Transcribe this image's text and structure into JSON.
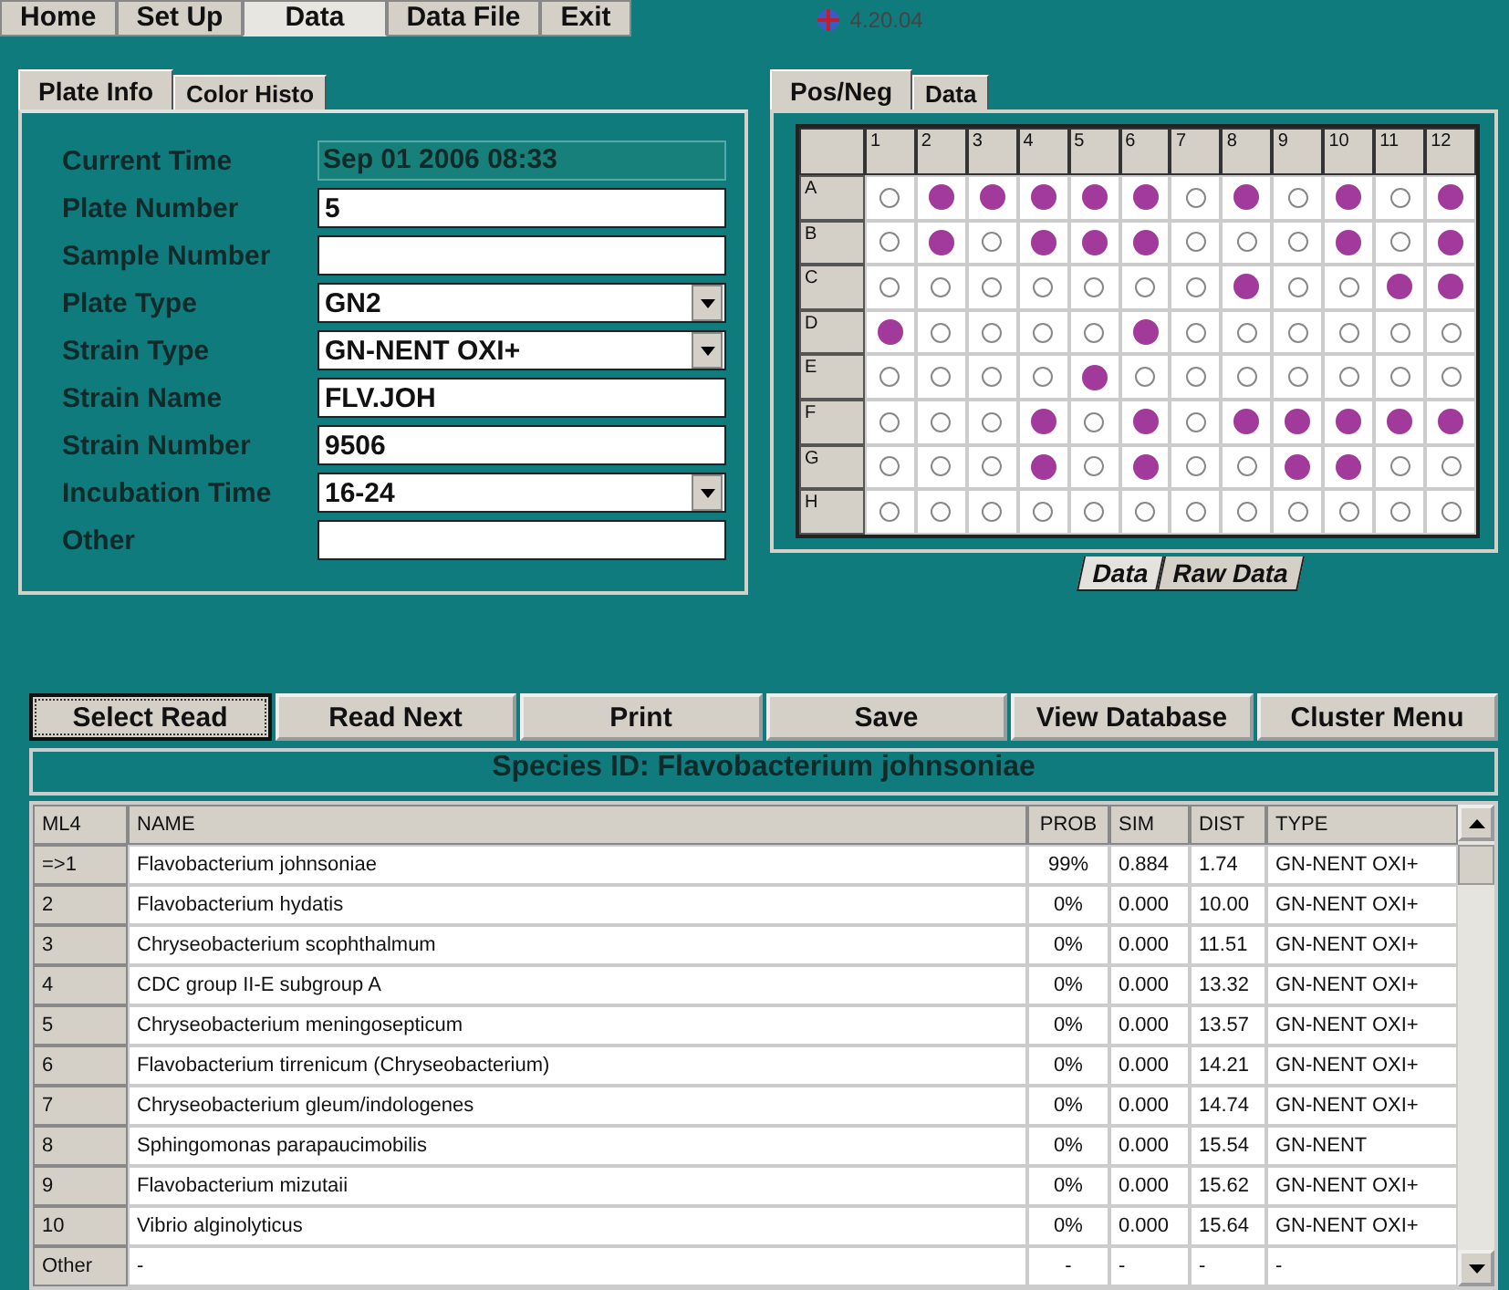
{
  "menu": [
    {
      "label": "Home",
      "selected": false
    },
    {
      "label": "Set Up",
      "selected": false
    },
    {
      "label": "Data",
      "selected": true
    },
    {
      "label": "Data File",
      "selected": false
    },
    {
      "label": "Exit",
      "selected": false
    }
  ],
  "version": "4.20.04",
  "left_tabs": [
    {
      "label": "Plate Info",
      "selected": true
    },
    {
      "label": "Color Histo",
      "selected": false
    }
  ],
  "fields": [
    {
      "label": "Current Time",
      "kind": "display",
      "value": "Sep 01 2006 08:33"
    },
    {
      "label": "Plate Number",
      "kind": "text",
      "value": "5"
    },
    {
      "label": "Sample Number",
      "kind": "text"
    },
    {
      "label": "Plate Type",
      "kind": "select",
      "value": "GN2"
    },
    {
      "label": "Strain Type",
      "kind": "select",
      "value": "GN-NENT OXI+"
    },
    {
      "label": "Strain Name",
      "kind": "text",
      "value": "FLV.JOH"
    },
    {
      "label": "Strain Number",
      "kind": "text",
      "value": "9506"
    },
    {
      "label": "Incubation Time",
      "kind": "select",
      "value": "16-24"
    },
    {
      "label": "Other",
      "kind": "text"
    }
  ],
  "right_tabs": [
    {
      "label": "Pos/Neg",
      "selected": true
    },
    {
      "label": "Data",
      "selected": false
    }
  ],
  "plate": {
    "columns": [
      "1",
      "2",
      "3",
      "4",
      "5",
      "6",
      "7",
      "8",
      "9",
      "10",
      "11",
      "12"
    ],
    "rows": [
      {
        "label": "A",
        "positive": [
          false,
          true,
          true,
          true,
          true,
          true,
          false,
          true,
          false,
          true,
          false,
          true
        ]
      },
      {
        "label": "B",
        "positive": [
          false,
          true,
          false,
          true,
          true,
          true,
          false,
          false,
          false,
          true,
          false,
          true
        ]
      },
      {
        "label": "C",
        "positive": [
          false,
          false,
          false,
          false,
          false,
          false,
          false,
          true,
          false,
          false,
          true,
          true
        ]
      },
      {
        "label": "D",
        "positive": [
          true,
          false,
          false,
          false,
          false,
          true,
          false,
          false,
          false,
          false,
          false,
          false
        ]
      },
      {
        "label": "E",
        "positive": [
          false,
          false,
          false,
          false,
          true,
          false,
          false,
          false,
          false,
          false,
          false,
          false
        ]
      },
      {
        "label": "F",
        "positive": [
          false,
          false,
          false,
          true,
          false,
          true,
          false,
          true,
          true,
          true,
          true,
          true
        ]
      },
      {
        "label": "G",
        "positive": [
          false,
          false,
          false,
          true,
          false,
          true,
          false,
          false,
          true,
          true,
          false,
          false
        ]
      },
      {
        "label": "H",
        "positive": [
          false,
          false,
          false,
          false,
          false,
          false,
          false,
          false,
          false,
          false,
          false,
          false
        ]
      }
    ]
  },
  "bottom_tabs": [
    {
      "label": "Data",
      "selected": true
    },
    {
      "label": "Raw Data",
      "selected": false
    }
  ],
  "buttons": [
    {
      "label": "Select Read",
      "selected": true
    },
    {
      "label": "Read Next",
      "selected": false
    },
    {
      "label": "Print",
      "selected": false
    },
    {
      "label": "Save",
      "selected": false
    },
    {
      "label": "View Database",
      "selected": false
    },
    {
      "label": "Cluster Menu",
      "selected": false
    }
  ],
  "species_title": "Species ID: Flavobacterium johnsoniae",
  "table": {
    "columns": [
      "ML4",
      "NAME",
      "PROB",
      "SIM",
      "DIST",
      "TYPE"
    ],
    "rows": [
      [
        "=>1",
        "Flavobacterium johnsoniae",
        "99%",
        "0.884",
        "1.74",
        "GN-NENT OXI+"
      ],
      [
        "2",
        "Flavobacterium hydatis",
        "0%",
        "0.000",
        "10.00",
        "GN-NENT OXI+"
      ],
      [
        "3",
        "Chryseobacterium scophthalmum",
        "0%",
        "0.000",
        "11.51",
        "GN-NENT OXI+"
      ],
      [
        "4",
        "CDC group II-E subgroup A",
        "0%",
        "0.000",
        "13.32",
        "GN-NENT OXI+"
      ],
      [
        "5",
        "Chryseobacterium meningosepticum",
        "0%",
        "0.000",
        "13.57",
        "GN-NENT OXI+"
      ],
      [
        "6",
        "Flavobacterium tirrenicum (Chryseobacterium)",
        "0%",
        "0.000",
        "14.21",
        "GN-NENT OXI+"
      ],
      [
        "7",
        "Chryseobacterium gleum/indologenes",
        "0%",
        "0.000",
        "14.74",
        "GN-NENT OXI+"
      ],
      [
        "8",
        "Sphingomonas parapaucimobilis",
        "0%",
        "0.000",
        "15.54",
        "GN-NENT"
      ],
      [
        "9",
        "Flavobacterium mizutaii",
        "0%",
        "0.000",
        "15.62",
        "GN-NENT OXI+"
      ],
      [
        "10",
        "Vibrio alginolyticus",
        "0%",
        "0.000",
        "15.64",
        "GN-NENT OXI+"
      ],
      [
        "Other",
        "-",
        "-",
        "-",
        "-",
        "-"
      ]
    ]
  }
}
